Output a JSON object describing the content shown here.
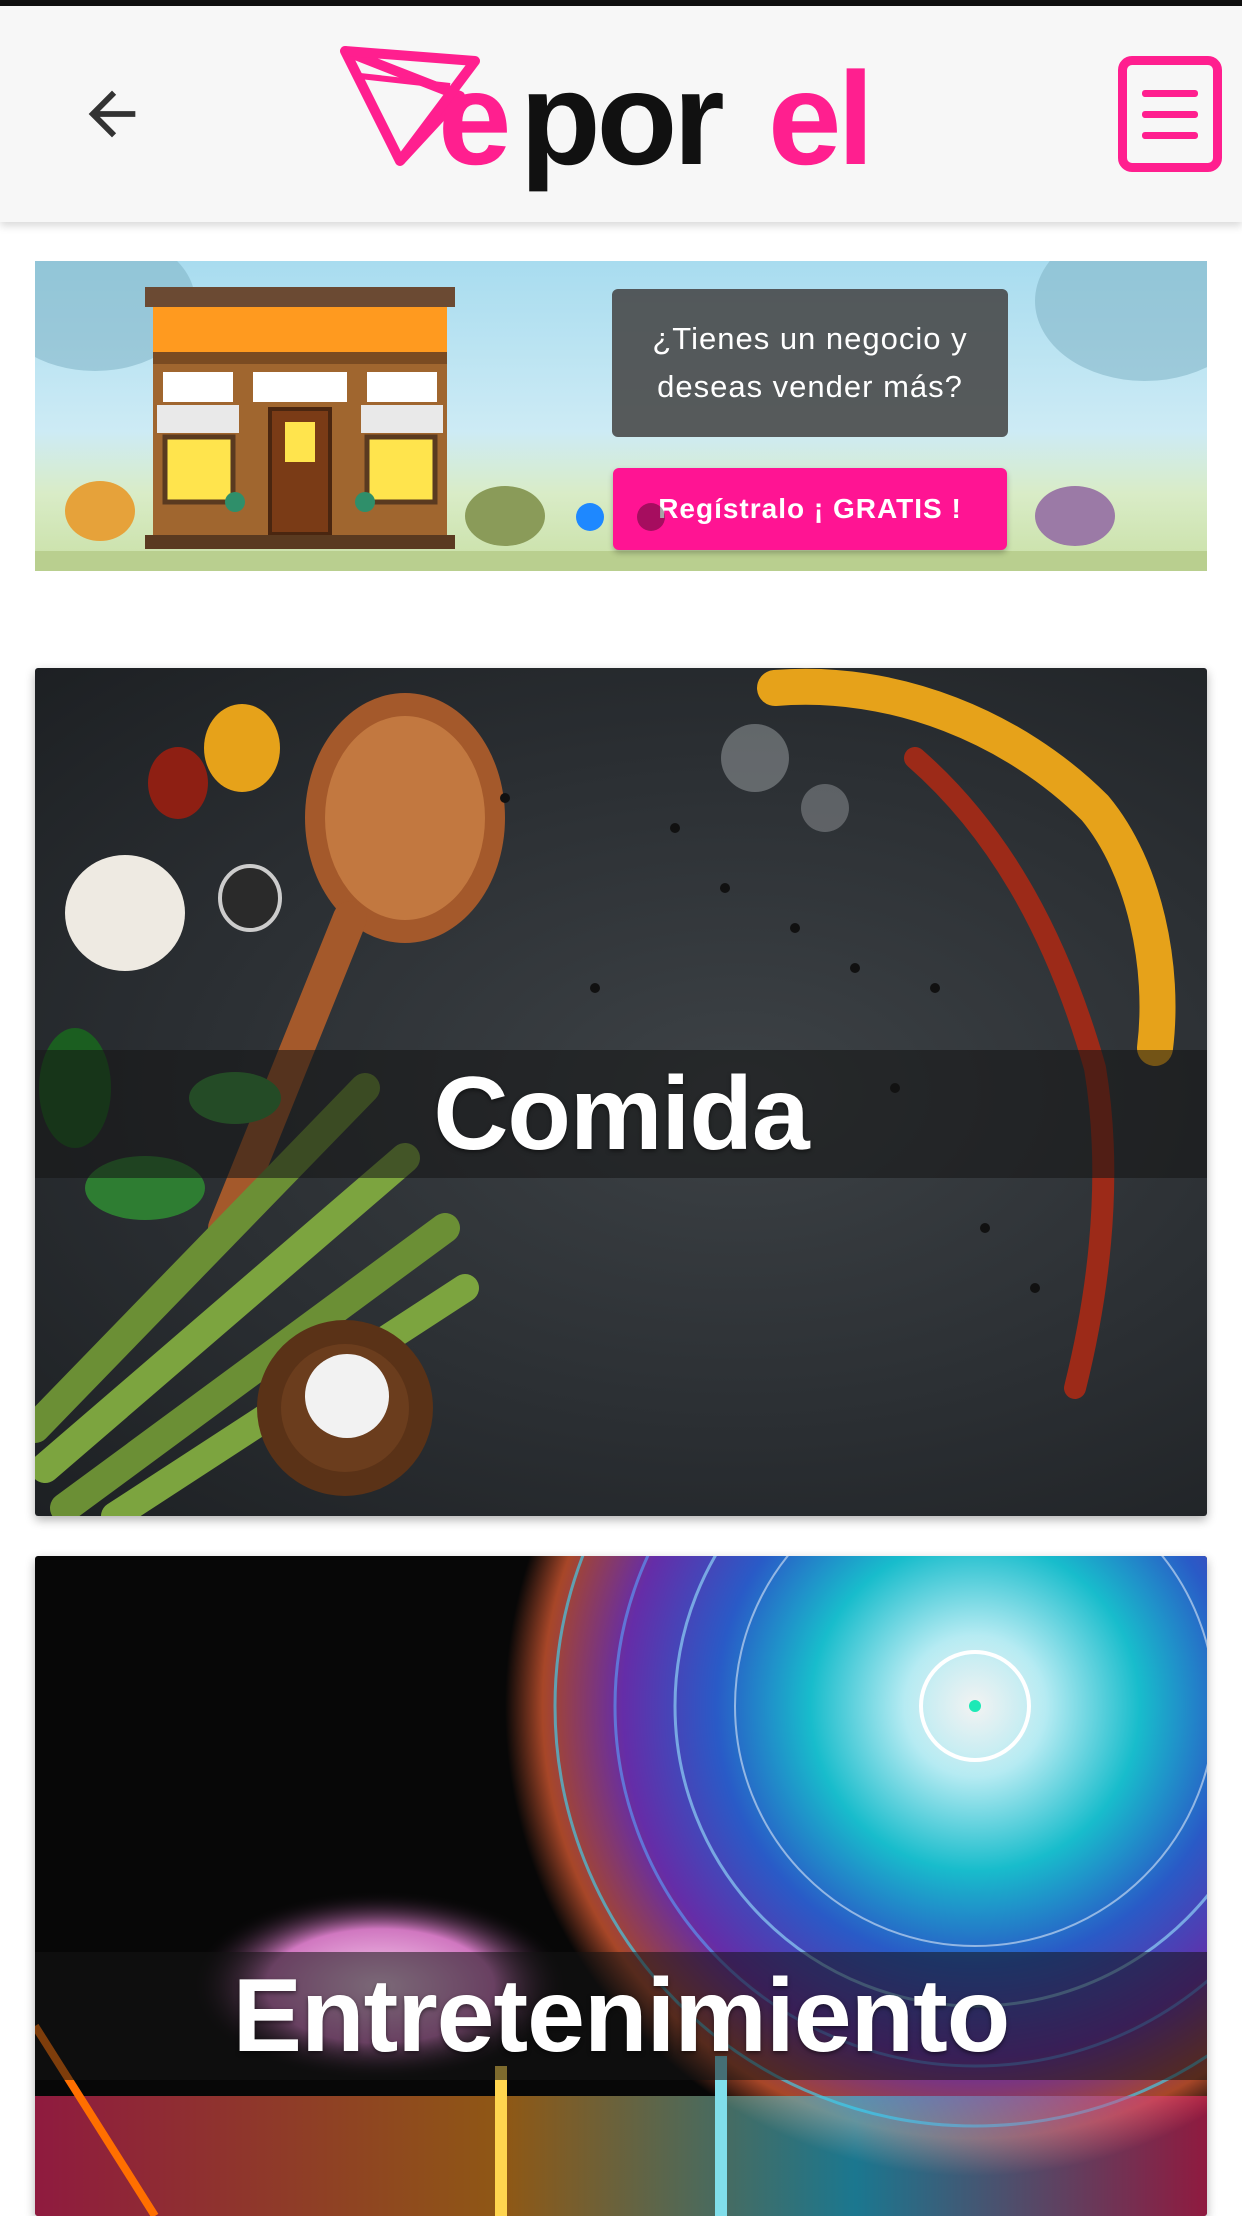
{
  "app": {
    "logo_text": "eporel",
    "colors": {
      "brand_pink": "#ff1f8f",
      "brand_dark": "#111111",
      "carousel_active": "#1e88ff"
    }
  },
  "header": {
    "back_icon": "arrow-left-icon",
    "menu_icon": "menu-list-icon"
  },
  "banner": {
    "question": "¿Tienes un negocio y deseas vender más?",
    "cta_label": "Regístralo ¡ GRATIS !",
    "slides": 2,
    "active_slide": 1
  },
  "categories": [
    {
      "title": "Comida",
      "image": "spices-and-asparagus-on-slate"
    },
    {
      "title": "Entretenimiento",
      "image": "fair-rides-long-exposure-night"
    }
  ]
}
